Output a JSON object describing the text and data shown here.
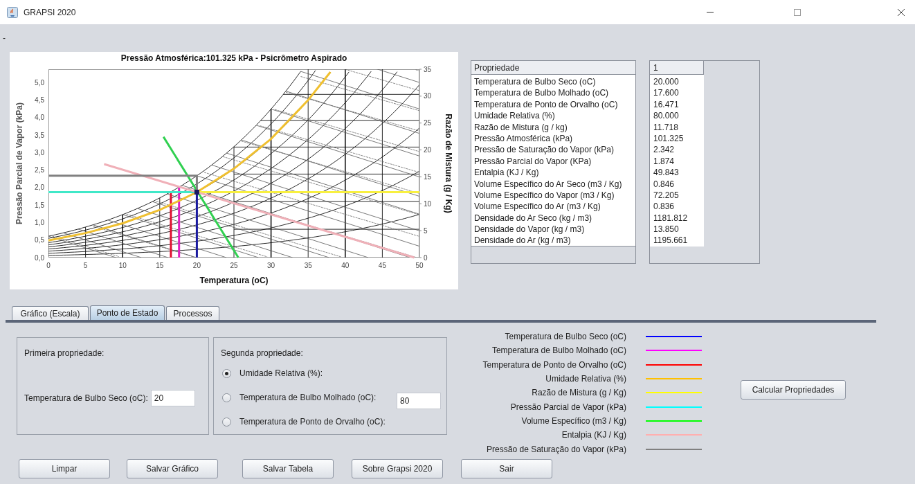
{
  "window": {
    "title": "GRAPSI 2020"
  },
  "menu_text": "-",
  "chart": {
    "chart_data": {
      "type": "line",
      "title": "Pressão Atmosférica:101.325 kPa - Psicrômetro Aspirado",
      "xlabel": "Temperatura (oC)",
      "ylabel": "Pressão Parcial de Vapor (kPa)",
      "y2label": "Razão de Mistura (g / Kg)",
      "xlim": [
        0,
        50
      ],
      "ylim": [
        0,
        5.38
      ],
      "y2lim": [
        0,
        35
      ],
      "xticks": [
        0,
        5,
        10,
        15,
        20,
        25,
        30,
        35,
        40,
        45,
        50
      ],
      "yticks": [
        {
          "value": 0,
          "label": "0,0"
        },
        {
          "value": 0.5,
          "label": "0,5"
        },
        {
          "value": 1,
          "label": "1,0"
        },
        {
          "value": 1.5,
          "label": "1,5"
        },
        {
          "value": 2,
          "label": "2,0"
        },
        {
          "value": 2.5,
          "label": "2,5"
        },
        {
          "value": 3,
          "label": "3,0"
        },
        {
          "value": 3.5,
          "label": "3,5"
        },
        {
          "value": 4,
          "label": "4,0"
        },
        {
          "value": 4.5,
          "label": "4,5"
        },
        {
          "value": 5,
          "label": "5,0"
        }
      ],
      "y2ticks": [
        0,
        5,
        10,
        15,
        20,
        25,
        30,
        35
      ],
      "series": [
        {
          "color": "#1a1aa0",
          "x": [
            20,
            20
          ],
          "values": [
            0,
            1.87
          ]
        },
        {
          "color": "#e020c0",
          "x": [
            17.6,
            17.6
          ],
          "values": [
            0,
            2.0
          ]
        },
        {
          "color": "#e01030",
          "x": [
            16.5,
            16.5
          ],
          "values": [
            0,
            1.87
          ]
        },
        {
          "color": "#f0c030",
          "x": [
            0,
            5,
            10,
            15,
            20,
            25,
            30,
            35,
            38
          ],
          "values": [
            0.49,
            0.7,
            0.98,
            1.36,
            1.87,
            2.54,
            3.39,
            4.5,
            5.3
          ]
        },
        {
          "color": "#f8f040",
          "x": [
            20,
            50
          ],
          "values": [
            1.87,
            1.87
          ]
        },
        {
          "color": "#40e8c8",
          "x": [
            0,
            20
          ],
          "values": [
            1.87,
            1.87
          ]
        },
        {
          "color": "#30d050",
          "x": [
            15.5,
            25.6
          ],
          "values": [
            3.45,
            0
          ]
        },
        {
          "color": "#f0b0b8",
          "x": [
            7.5,
            49.3
          ],
          "values": [
            2.67,
            0
          ]
        },
        {
          "color": "#808080",
          "x": [
            0,
            20,
            20
          ],
          "values": [
            2.34,
            2.34,
            1.87
          ]
        }
      ]
    }
  },
  "properties_table": {
    "columns": [
      "Propriedade",
      "1"
    ],
    "rows": [
      {
        "property": "Temperatura de Bulbo Seco (oC)",
        "value": "20.000"
      },
      {
        "property": "Temperatura de Bulbo Molhado (oC)",
        "value": "17.600"
      },
      {
        "property": "Temperatura de Ponto de Orvalho (oC)",
        "value": "16.471"
      },
      {
        "property": "Umidade Relativa (%)",
        "value": "80.000"
      },
      {
        "property": "Razão de Mistura (g / kg)",
        "value": "11.718"
      },
      {
        "property": "Pressão Atmosférica (kPa)",
        "value": "101.325"
      },
      {
        "property": "Pressão de Saturação do Vapor (kPa)",
        "value": "2.342"
      },
      {
        "property": "Pressão Parcial do Vapor (KPa)",
        "value": "1.874"
      },
      {
        "property": "Entalpia (KJ / Kg)",
        "value": "49.843"
      },
      {
        "property": "Volume Específico do Ar Seco (m3 / Kg)",
        "value": "0.846"
      },
      {
        "property": "Volume Específico do Vapor (m3 / Kg)",
        "value": "72.205"
      },
      {
        "property": "Volume Específico do Ar (m3 / Kg)",
        "value": "0.836"
      },
      {
        "property": "Densidade do Ar Seco (kg / m3)",
        "value": "1181.812"
      },
      {
        "property": "Densidade do Vapor (kg / m3)",
        "value": "13.850"
      },
      {
        "property": "Densidade do Ar (kg / m3)",
        "value": "1195.661"
      }
    ]
  },
  "tabs": [
    {
      "label": "Gráfico (Escala)",
      "selected": false
    },
    {
      "label": "Ponto de Estado",
      "selected": true
    },
    {
      "label": "Processos",
      "selected": false
    }
  ],
  "first_property": {
    "title": "Primeira propriedade:",
    "label": "Temperatura de Bulbo Seco (oC):",
    "value": "20"
  },
  "second_property": {
    "title": "Segunda propriedade:",
    "options": [
      {
        "label": "Umidade Relativa (%):",
        "selected": true
      },
      {
        "label": "Temperatura de Bulbo Molhado (oC):",
        "selected": false
      },
      {
        "label": "Temperatura de Ponto de Orvalho (oC):",
        "selected": false
      }
    ],
    "value": "80"
  },
  "legend": [
    {
      "label": "Temperatura de Bulbo Seco (oC)",
      "color": "#0000ff"
    },
    {
      "label": "Temperatura de Bulbo Molhado (oC)",
      "color": "#ff00ff"
    },
    {
      "label": "Temperatura de Ponto de Orvalho (oC)",
      "color": "#ff0000"
    },
    {
      "label": "Umidade Relativa (%)",
      "color": "#ffc000"
    },
    {
      "label": "Razão de Mistura (g / Kg)",
      "color": "#ffff00"
    },
    {
      "label": "Pressão Parcial de Vapor (kPa)",
      "color": "#00ffff"
    },
    {
      "label": "Volume Específico (m3 / Kg)",
      "color": "#00ff00"
    },
    {
      "label": "Entalpia (KJ / Kg)",
      "color": "#ffafaf"
    },
    {
      "label": "Pressão de Saturação do Vapor (kPa)",
      "color": "#808080"
    }
  ],
  "calculate_button": "Calcular Propriedades",
  "buttons": [
    "Limpar",
    "Salvar Gráfico",
    "Salvar Tabela",
    "Sobre Grapsi 2020",
    "Sair"
  ]
}
